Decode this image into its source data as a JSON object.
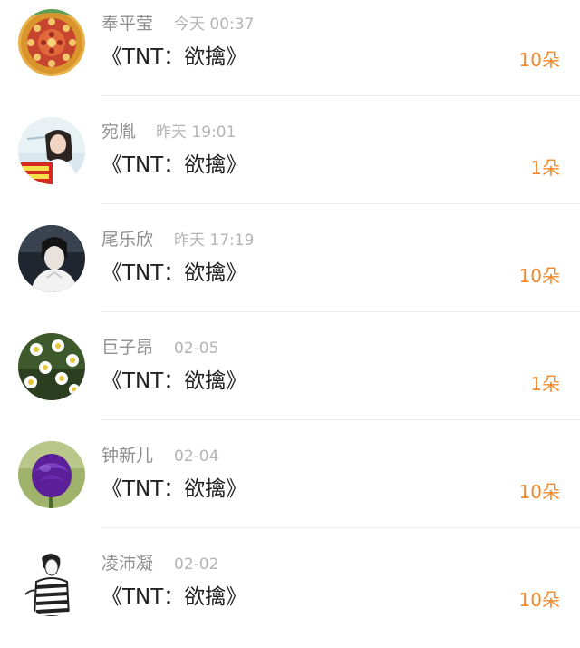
{
  "records": [
    {
      "user": "奉平莹",
      "time": "今天 00:37",
      "title": "《TNT：欲擒》",
      "flowers": "10朵",
      "avatar_icon": "embroidery-avatar-icon"
    },
    {
      "user": "宛胤",
      "time": "昨天 19:01",
      "title": "《TNT：欲擒》",
      "flowers": "1朵",
      "avatar_icon": "girl-avatar-icon"
    },
    {
      "user": "尾乐欣",
      "time": "昨天 17:19",
      "title": "《TNT：欲擒》",
      "flowers": "10朵",
      "avatar_icon": "boy-avatar-icon"
    },
    {
      "user": "巨子昂",
      "time": "02-05",
      "title": "《TNT：欲擒》",
      "flowers": "1朵",
      "avatar_icon": "daisy-avatar-icon"
    },
    {
      "user": "钟新儿",
      "time": "02-04",
      "title": "《TNT：欲擒》",
      "flowers": "10朵",
      "avatar_icon": "purple-rose-avatar-icon"
    },
    {
      "user": "凌沛凝",
      "time": "02-02",
      "title": "《TNT：欲擒》",
      "flowers": "10朵",
      "avatar_icon": "sketch-avatar-icon"
    }
  ],
  "colors": {
    "username": "#8f8f8f",
    "timestamp": "#b4b4b4",
    "title": "#222222",
    "flower_count": "#f08a2c",
    "divider": "#ececec"
  }
}
